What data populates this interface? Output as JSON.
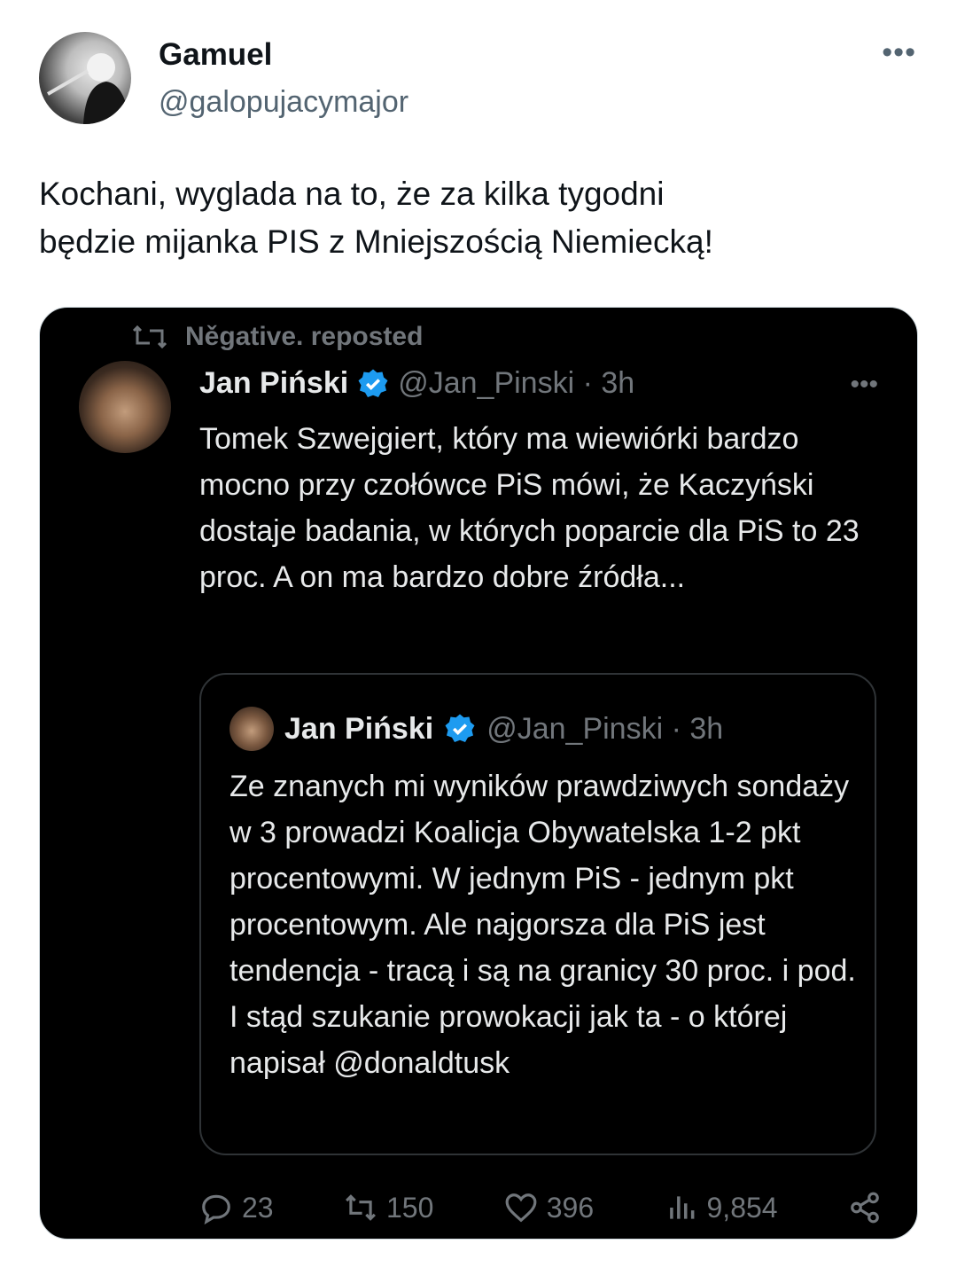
{
  "tweet": {
    "author_name": "Gamuel",
    "author_handle": "@galopujacymajor",
    "more_label": "•••",
    "text_line1": "Kochani, wyglada na to, że za kilka tygodni",
    "text_line2": "będzie mijanka PIS z Mniejszością Niemiecką!"
  },
  "embedded": {
    "repost_label": "Něgative. reposted",
    "author_name": "Jan Piński",
    "author_handle": "@Jan_Pinski · 3h",
    "more_label": "•••",
    "text": "Tomek Szwejgiert, który ma wiewiórki bardzo mocno przy czołówce PiS mówi, że Kaczyński dostaje badania, w których poparcie dla PiS to 23 proc. A on ma bardzo dobre źródła...",
    "quote": {
      "author_name": "Jan Piński",
      "author_handle": "@Jan_Pinski · 3h",
      "text": "Ze znanych mi wyników prawdziwych sondaży w 3  prowadzi Koalicja Obywatelska 1-2 pkt procentowymi. W jednym PiS - jednym pkt procentowym. Ale najgorsza dla PiS jest tendencja - tracą i są na granicy 30 proc. i pod. I stąd szukanie prowokacji jak ta - o której napisał @donaldtusk"
    },
    "actions": {
      "replies": "23",
      "reposts": "150",
      "likes": "396",
      "views": "9,854"
    }
  },
  "colors": {
    "verified": "#1d9bf0",
    "muted": "#71767b",
    "text_dark": "#0f1419"
  },
  "icons": [
    "avatar",
    "repost-icon",
    "verified-icon",
    "reply-icon",
    "like-icon",
    "views-icon",
    "share-icon",
    "more-icon"
  ]
}
